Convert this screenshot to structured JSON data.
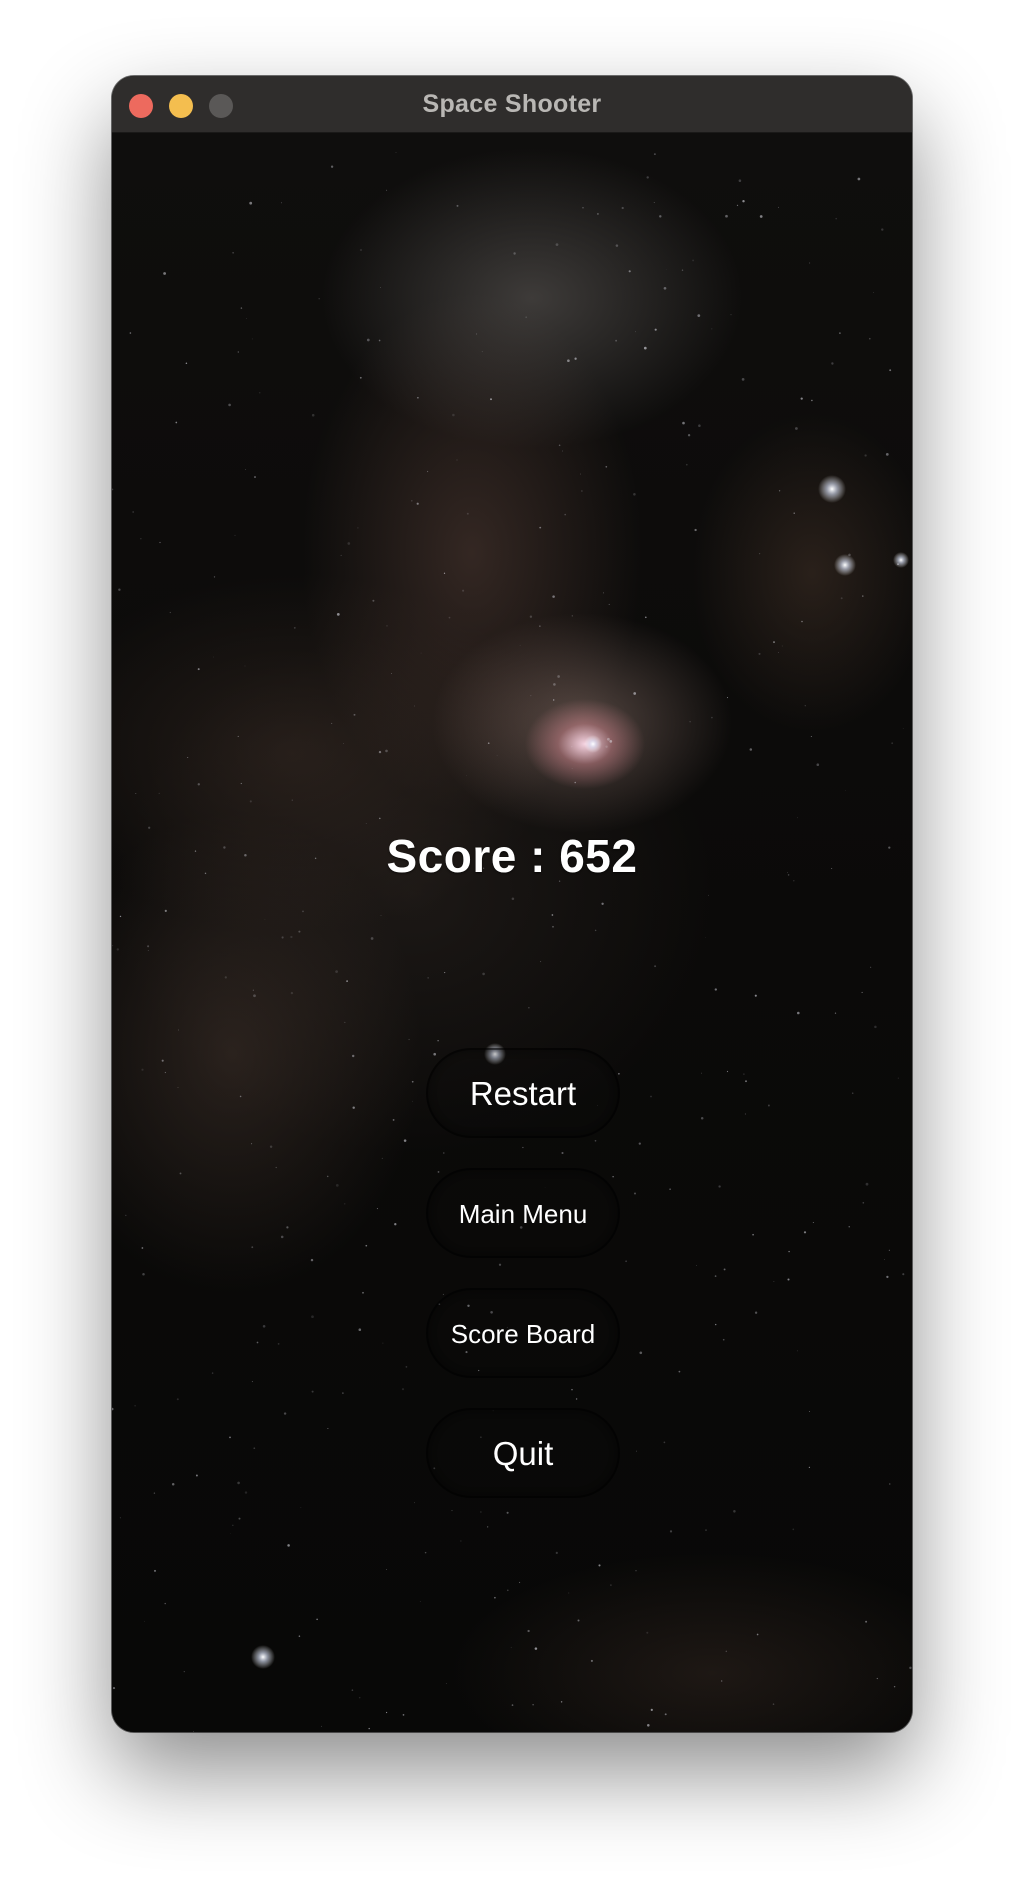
{
  "window": {
    "title": "Space Shooter",
    "controls": [
      "close",
      "minimize",
      "zoom"
    ]
  },
  "game": {
    "score_text": "Score : 652",
    "buttons": {
      "restart": "Restart",
      "main_menu": "Main Menu",
      "score_board": "Score Board",
      "quit": "Quit"
    }
  },
  "colors": {
    "titlebar": "#2f2d2c",
    "close": "#ed6a5e",
    "minimize": "#f4be4f",
    "zoom": "#5a5857",
    "text": "#ffffff"
  }
}
